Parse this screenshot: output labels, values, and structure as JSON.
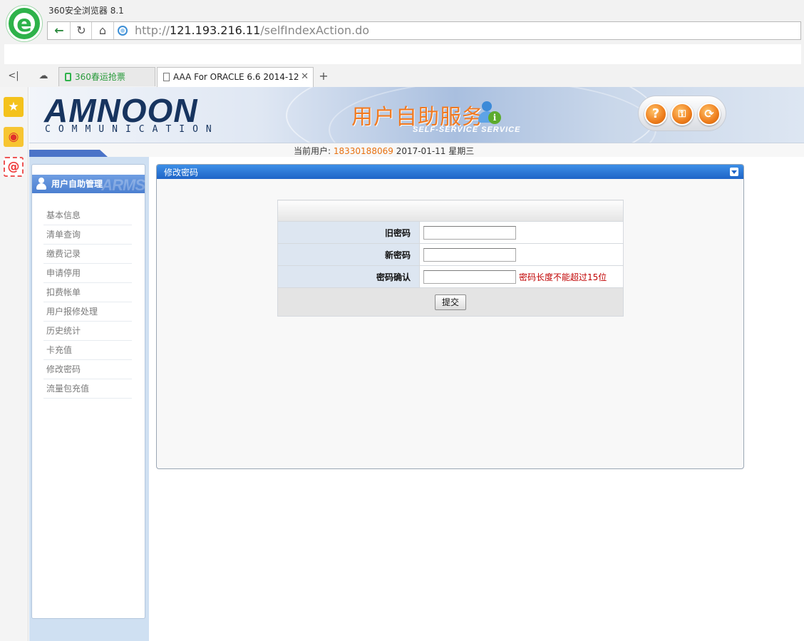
{
  "browser": {
    "window_title": "360安全浏览器 8.1",
    "url_scheme": "http://",
    "url_host": "121.193.216.11",
    "url_path": "/selfIndexAction.do",
    "tabs": [
      {
        "label": "360春运抢票"
      },
      {
        "label": "AAA For ORACLE 6.6 2014-12"
      }
    ]
  },
  "header": {
    "brand": "AMNOON",
    "brand_sub": "COMMUNICATION",
    "service_title": "用户自助服务",
    "service_subtitle": "SELF-SERVICE SERVICE"
  },
  "userline": {
    "label": "当前用户:",
    "user_id": "18330188069",
    "date": "2017-01-11",
    "weekday": "星期三"
  },
  "menu": {
    "title": "用户自助管理",
    "title_watermark": "ARMS",
    "items": [
      {
        "label": "基本信息"
      },
      {
        "label": "清单查询"
      },
      {
        "label": "缴费记录"
      },
      {
        "label": "申请停用"
      },
      {
        "label": "扣费帐单"
      },
      {
        "label": "用户报修处理"
      },
      {
        "label": "历史统计"
      },
      {
        "label": "卡充值"
      },
      {
        "label": "修改密码"
      },
      {
        "label": "流量包充值"
      }
    ]
  },
  "panel": {
    "title": "修改密码",
    "fields": {
      "old_password": {
        "label": "旧密码",
        "value": ""
      },
      "new_password": {
        "label": "新密码",
        "value": ""
      },
      "confirm_password": {
        "label": "密码确认",
        "value": "",
        "hint": "密码长度不能超过15位"
      }
    },
    "submit_label": "提交"
  },
  "colors": {
    "panel_header": "#1f64c7",
    "accent_orange": "#e8700f",
    "hint_red": "#c00000",
    "label_cell_bg": "#dde6f1"
  }
}
